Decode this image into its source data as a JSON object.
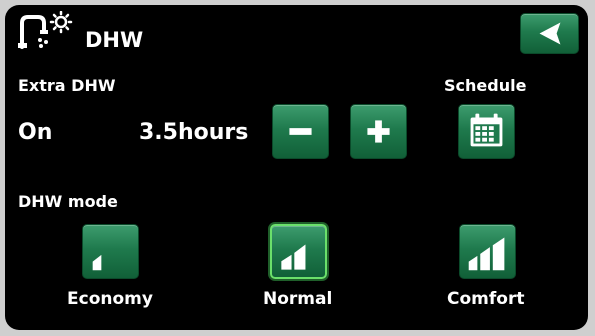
{
  "header": {
    "icon": "tap-with-sun-icon",
    "title": "DHW",
    "back_icon": "back-arrow-icon"
  },
  "extra_dhw": {
    "label": "Extra DHW",
    "status": "On",
    "duration": "3.5hours",
    "decrease_icon": "minus-icon",
    "increase_icon": "plus-icon"
  },
  "schedule": {
    "label": "Schedule",
    "icon": "calendar-icon"
  },
  "dhw_mode": {
    "label": "DHW mode",
    "options": [
      {
        "label": "Economy",
        "level": 1,
        "icon": "bars-1-icon"
      },
      {
        "label": "Normal",
        "level": 2,
        "icon": "bars-2-icon",
        "selected": true
      },
      {
        "label": "Comfort",
        "level": 3,
        "icon": "bars-3-icon"
      }
    ]
  },
  "colors": {
    "accent": "#1f7a4d",
    "selected_border": "#6be06b",
    "background": "#000000",
    "text": "#ffffff"
  }
}
